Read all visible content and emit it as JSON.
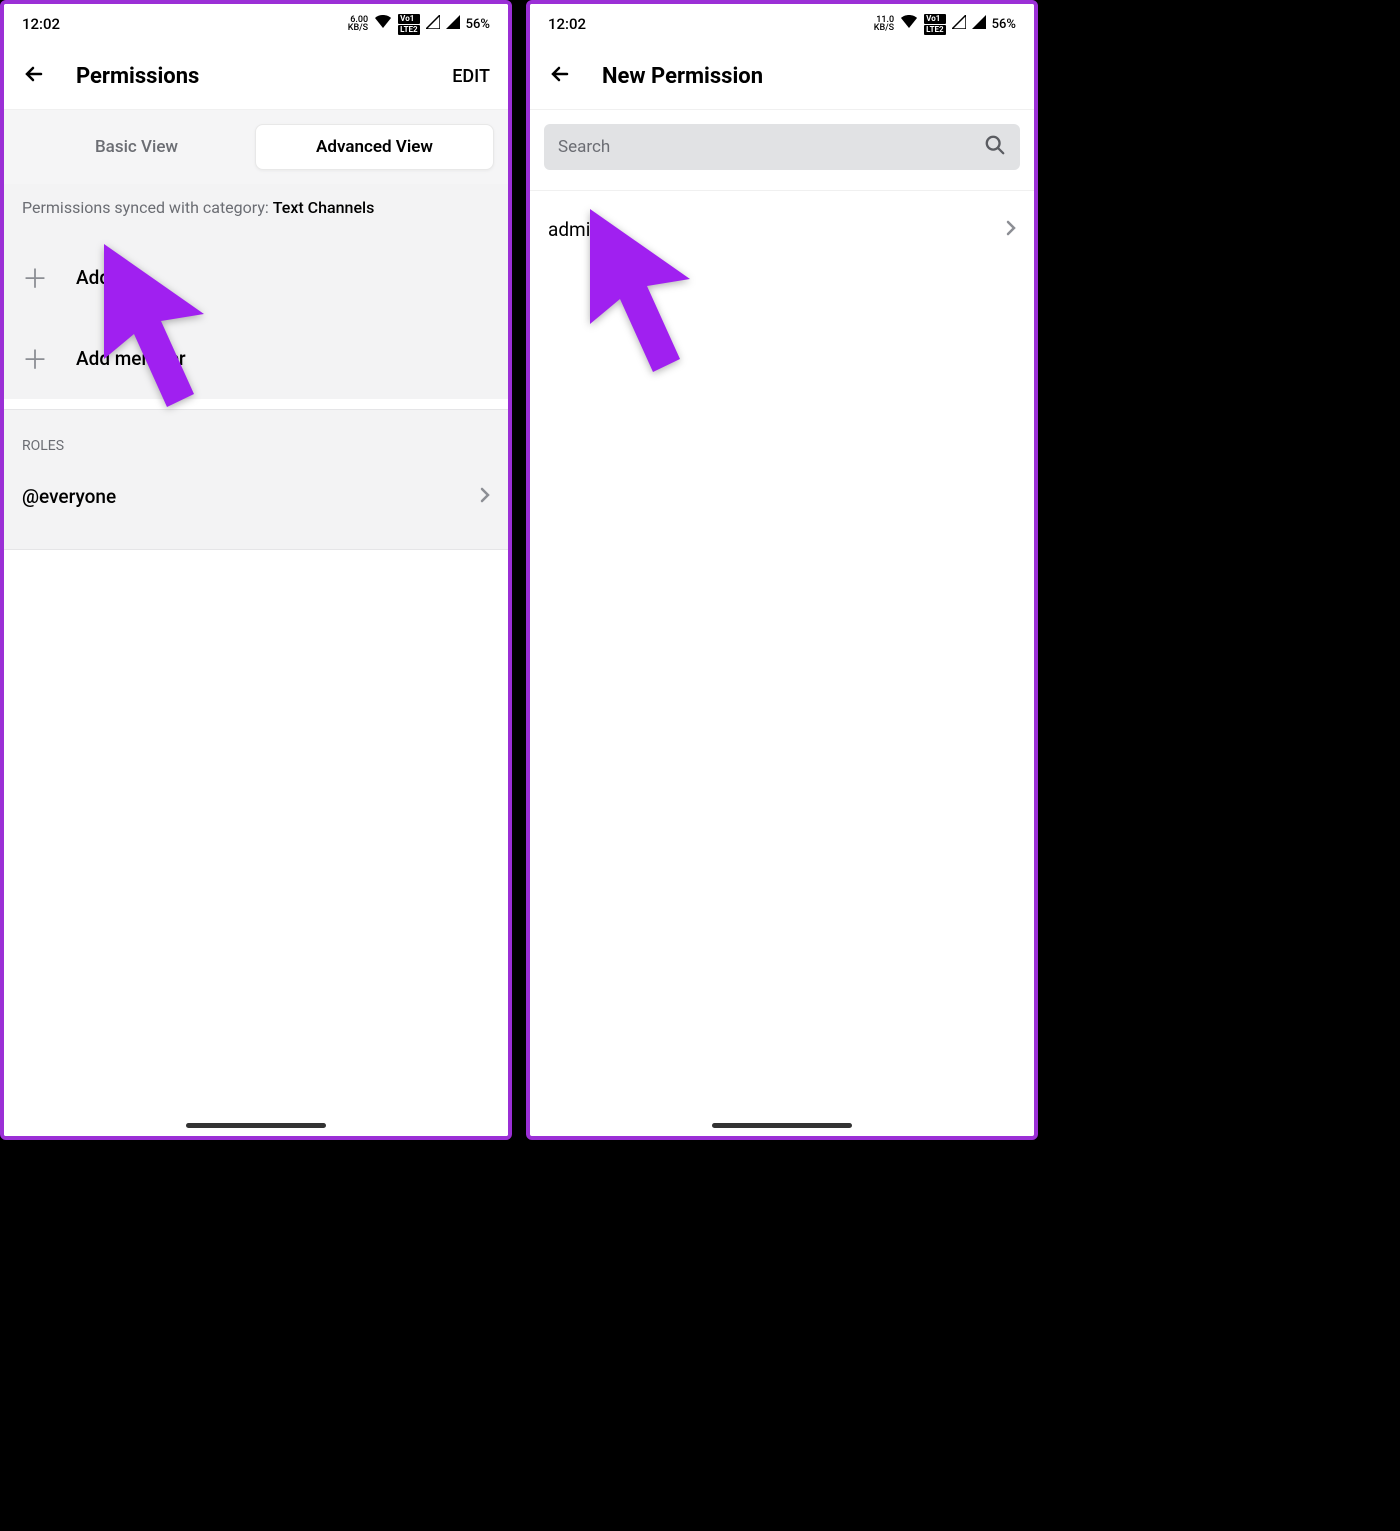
{
  "left": {
    "status": {
      "time": "12:02",
      "speed_top": "6.00",
      "speed_unit": "KB/S",
      "lte1": "Vo1",
      "lte2": "LTE2",
      "battery": "56%"
    },
    "header": {
      "title": "Permissions",
      "edit": "EDIT"
    },
    "tabs": {
      "basic": "Basic View",
      "advanced": "Advanced View"
    },
    "sync_prefix": "Permissions synced with category: ",
    "sync_category": "Text Channels",
    "add_role": "Add role",
    "add_member": "Add member",
    "section_roles": "ROLES",
    "role_everyone": "@everyone"
  },
  "right": {
    "status": {
      "time": "12:02",
      "speed_top": "11.0",
      "speed_unit": "KB/S",
      "lte1": "Vo1",
      "lte2": "LTE2",
      "battery": "56%"
    },
    "header": {
      "title": "New Permission"
    },
    "search": {
      "placeholder": "Search"
    },
    "result": "admin"
  }
}
